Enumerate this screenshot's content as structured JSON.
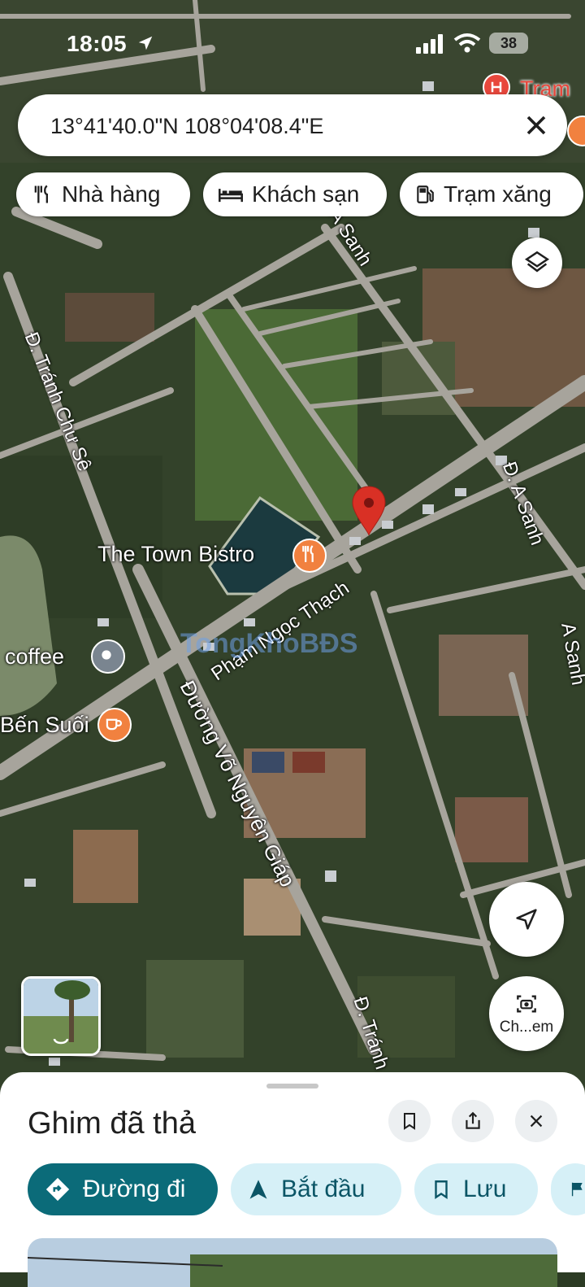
{
  "status_bar": {
    "time": "18:05",
    "battery": "38"
  },
  "search": {
    "value": "13°41'40.0\"N 108°04'08.4\"E"
  },
  "chips": [
    {
      "label": "Nhà hàng",
      "icon": "restaurant-icon"
    },
    {
      "label": "Khách sạn",
      "icon": "hotel-icon"
    },
    {
      "label": "Trạm xăng",
      "icon": "gas-station-icon"
    }
  ],
  "map_labels": {
    "bistro": "The Town Bistro",
    "coffee": "coffee",
    "ben_suoi": "Bến Suối",
    "tram": "Trạm",
    "street_tranh_chu_se": "Đ. Tránh Chư Sê",
    "street_a_sanh": "Đ. A Sanh",
    "street_a_sanh_2": "A Sanh",
    "street_a_sanh_top": "A Sanh",
    "street_pham_ngoc_thach": "Phạm Ngọc Thạch",
    "street_vo_nguyen_giap": "Đường Võ Nguyên Giáp",
    "street_tranh_bottom": "Đ. Tránh",
    "watermark": "TongKhoBĐS"
  },
  "street_view_label": "Ch...em",
  "sheet": {
    "title": "Ghim đã thả",
    "actions": [
      {
        "label": "Đường đi",
        "style": "primary"
      },
      {
        "label": "Bắt đầu",
        "style": "secondary"
      },
      {
        "label": "Lưu",
        "style": "secondary"
      }
    ]
  },
  "colors": {
    "primary": "#0b6b79",
    "pin": "#d93025",
    "poi_orange": "#f1813f",
    "poi_gray": "#7a8590"
  }
}
